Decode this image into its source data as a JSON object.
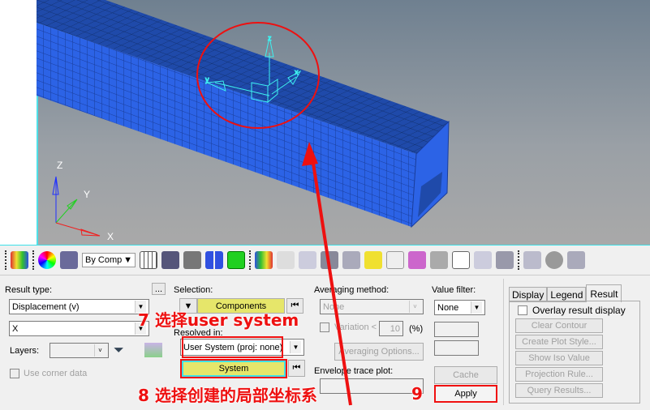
{
  "viewport": {
    "axis_labels": {
      "x": "X",
      "y": "Y",
      "z": "Z"
    },
    "local_axis_labels": {
      "x": "x",
      "y": "y",
      "z": "z"
    },
    "mesh_color": "#2c63e6"
  },
  "toolbar": {
    "by_comp": "By Comp"
  },
  "result_type": {
    "label": "Result type:",
    "more_button": "...",
    "type_value": "Displacement (v)",
    "component_value": "X",
    "layers_label": "Layers:",
    "layers_value": "",
    "use_corner_data": "Use corner data"
  },
  "selection": {
    "label": "Selection:",
    "components_button": "Components",
    "resolved_label": "Resolved in:",
    "resolved_value": "User System (proj: none)",
    "system_button": "System"
  },
  "averaging": {
    "label": "Averaging method:",
    "value": "None",
    "variation_label": "Variation <",
    "variation_value": "10",
    "variation_unit": "(%)",
    "options_button": "Averaging Options...",
    "envelope_label": "Envelope trace plot:",
    "envelope_value": ""
  },
  "value_filter": {
    "label": "Value filter:",
    "value": "None",
    "cache_button": "Cache",
    "apply_button": "Apply"
  },
  "tabs": [
    {
      "label": "Display"
    },
    {
      "label": "Legend"
    },
    {
      "label": "Result",
      "active": true
    }
  ],
  "result_tab": {
    "overlay": "Overlay result display",
    "buttons": [
      "Clear Contour",
      "Create Plot Style...",
      "Show Iso Value",
      "Projection Rule...",
      "Query Results..."
    ]
  },
  "annotations": {
    "step7": "7 选择user system",
    "step8": "8 选择创建的局部坐标系",
    "step9": "9",
    "color": "#ee1010"
  }
}
